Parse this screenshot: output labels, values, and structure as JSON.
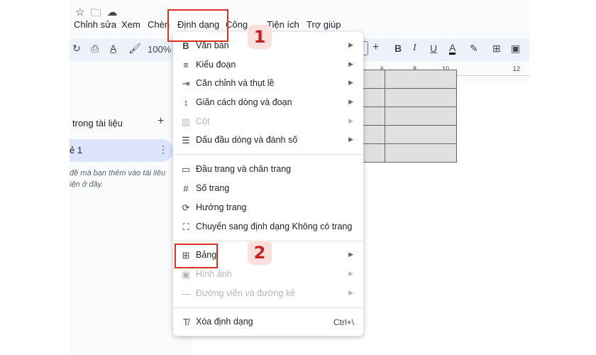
{
  "menubar": [
    "Chỉnh sửa",
    "Xem",
    "Chèn",
    "Định dạng",
    "Công",
    "Tiện ích",
    "Trợ giúp"
  ],
  "toolbar": {
    "zoom": "100%"
  },
  "sidebar": {
    "title": "trong tài liệu",
    "tab_label": "ẻ 1",
    "hint_line1": "đề mà bạn thêm vào tài liệu",
    "hint_line2": "iện ở đây."
  },
  "ruler": {
    "labels": [
      "6",
      "8",
      "10",
      "12"
    ]
  },
  "menu": {
    "items": [
      {
        "icon": "B",
        "label": "Văn bản",
        "arrow": true,
        "disabled": false
      },
      {
        "icon": "≡",
        "label": "Kiểu đoạn",
        "arrow": true,
        "disabled": false
      },
      {
        "icon": "⇥",
        "label": "Căn chỉnh và thụt lề",
        "arrow": true,
        "disabled": false
      },
      {
        "icon": "↕",
        "label": "Giãn cách dòng và đoạn",
        "arrow": true,
        "disabled": false
      },
      {
        "icon": "▥",
        "label": "Cột",
        "arrow": true,
        "disabled": true
      },
      {
        "icon": "☰",
        "label": "Dấu đầu dòng và đánh số",
        "arrow": true,
        "disabled": false
      },
      {
        "icon": "▭",
        "label": "Đầu trang và chân trang",
        "arrow": false,
        "disabled": false
      },
      {
        "icon": "#",
        "label": "Số trang",
        "arrow": false,
        "disabled": false
      },
      {
        "icon": "⟳",
        "label": "Hướng trang",
        "arrow": false,
        "disabled": false
      },
      {
        "icon": "⛶",
        "label": "Chuyển sang định dạng Không có trang",
        "arrow": false,
        "disabled": false
      },
      {
        "icon": "⊞",
        "label": "Bảng",
        "arrow": true,
        "disabled": false
      },
      {
        "icon": "▣",
        "label": "Hình ảnh",
        "arrow": true,
        "disabled": true
      },
      {
        "icon": "—",
        "label": "Đường viền và đường kẻ",
        "arrow": true,
        "disabled": true
      },
      {
        "icon": "T̸",
        "label": "Xóa định dạng",
        "arrow": false,
        "disabled": false,
        "shortcut": "Ctrl+\\"
      }
    ]
  },
  "annotations": {
    "step1": "1",
    "step2": "2"
  },
  "colors": {
    "highlight": "#d93025",
    "badge_bg": "#fde0dc",
    "badge_text": "#c5221f"
  }
}
